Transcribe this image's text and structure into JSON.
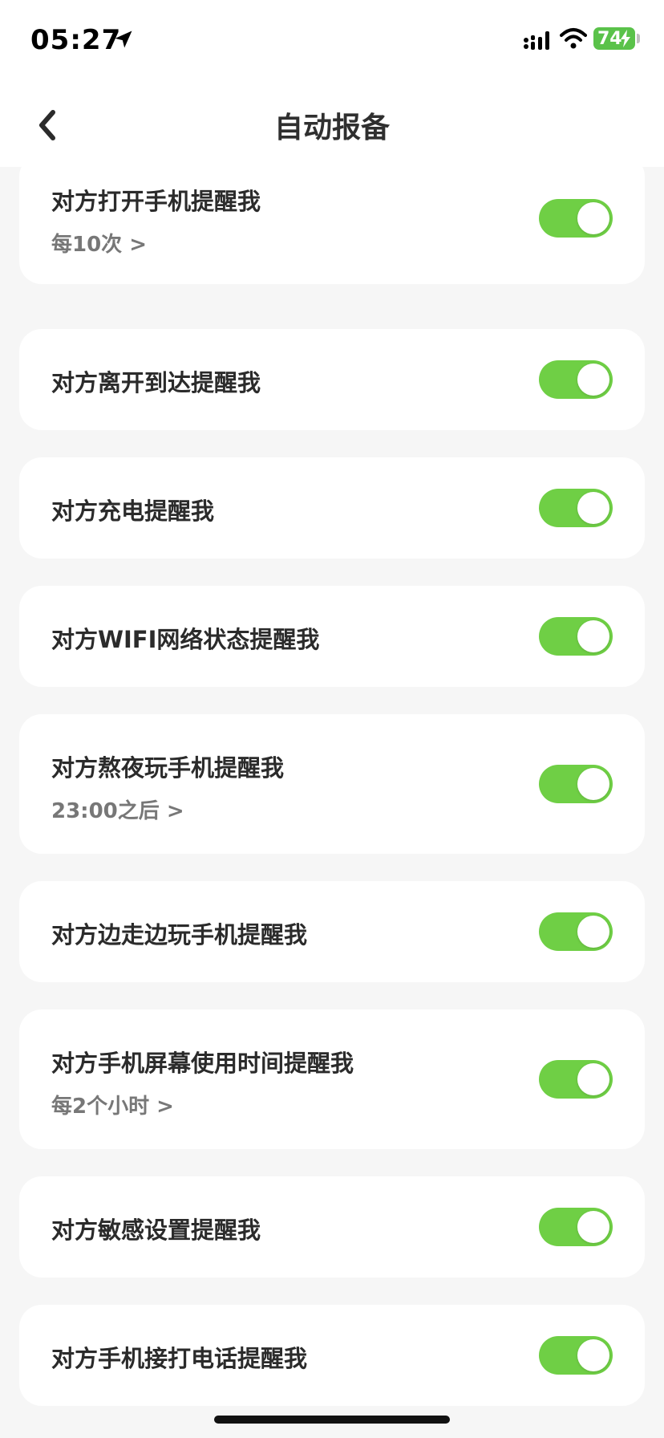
{
  "status_bar": {
    "time": "05:27",
    "battery": "74",
    "location_icon": "location-arrow-icon",
    "signal_icon": "cellular-signal-icon",
    "wifi_icon": "wifi-icon",
    "charging_icon": "charging-bolt-icon",
    "battery_color": "#5ac24a"
  },
  "nav": {
    "title": "自动报备",
    "back_icon": "chevron-left-icon"
  },
  "toggle_color": "#6fcf45",
  "items": [
    {
      "label": "对方打开手机提醒我",
      "sub": "每10次 >",
      "enabled": true
    },
    {
      "label": "对方离开到达提醒我",
      "enabled": true
    },
    {
      "label": "对方充电提醒我",
      "enabled": true
    },
    {
      "label": "对方WIFI网络状态提醒我",
      "enabled": true
    },
    {
      "label": "对方熬夜玩手机提醒我",
      "sub": "23:00之后 >",
      "enabled": true
    },
    {
      "label": "对方边走边玩手机提醒我",
      "enabled": true
    },
    {
      "label": "对方手机屏幕使用时间提醒我",
      "sub": "每2个小时 >",
      "enabled": true
    },
    {
      "label": "对方敏感设置提醒我",
      "enabled": true
    },
    {
      "label": "对方手机接打电话提醒我",
      "enabled": true
    }
  ]
}
